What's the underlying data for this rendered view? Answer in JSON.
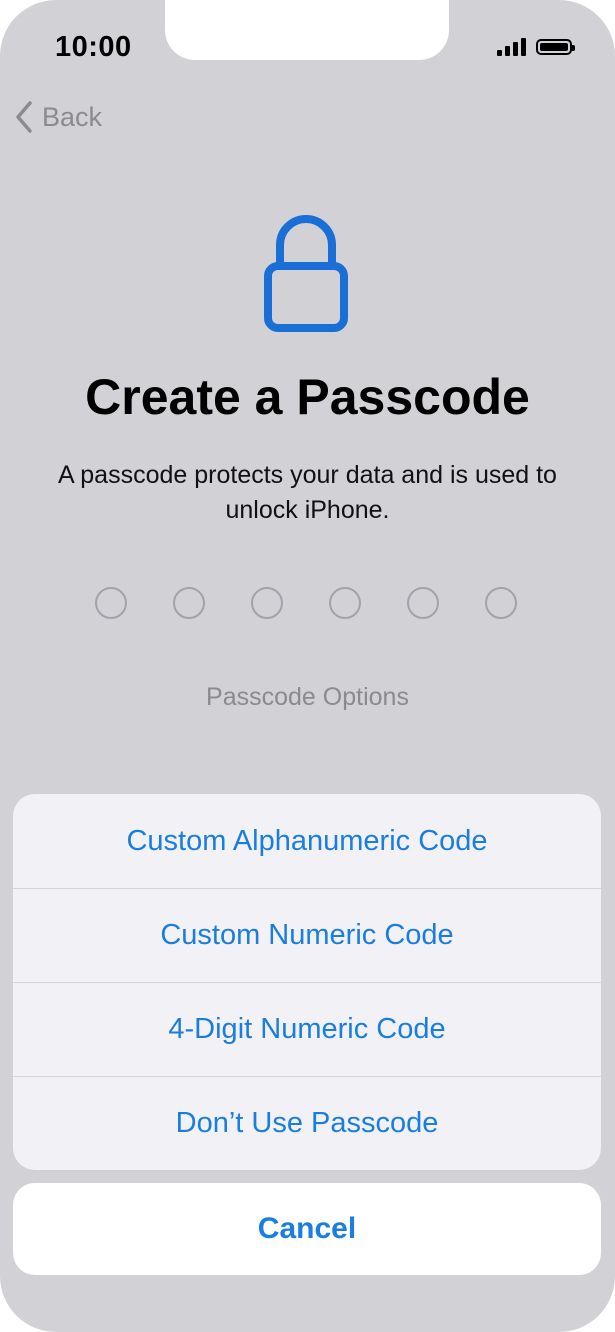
{
  "status_bar": {
    "time": "10:00"
  },
  "nav": {
    "back_label": "Back"
  },
  "header": {
    "title": "Create a Passcode",
    "subtitle": "A passcode protects your data and is used to unlock iPhone."
  },
  "passcode": {
    "digits": 6,
    "entered": 0
  },
  "options_link": "Passcode Options",
  "action_sheet": {
    "items": [
      {
        "label": "Custom Alphanumeric Code"
      },
      {
        "label": "Custom Numeric Code"
      },
      {
        "label": "4-Digit Numeric Code"
      },
      {
        "label": "Don’t Use Passcode"
      }
    ],
    "cancel_label": "Cancel"
  },
  "colors": {
    "accent": "#1a7de0",
    "lock_icon": "#1a6fd6",
    "background": "#d2d1d6",
    "sheet": "#f2f1f6"
  },
  "icons": [
    "chevron-left-icon",
    "lock-icon",
    "signal-icon",
    "battery-icon"
  ]
}
